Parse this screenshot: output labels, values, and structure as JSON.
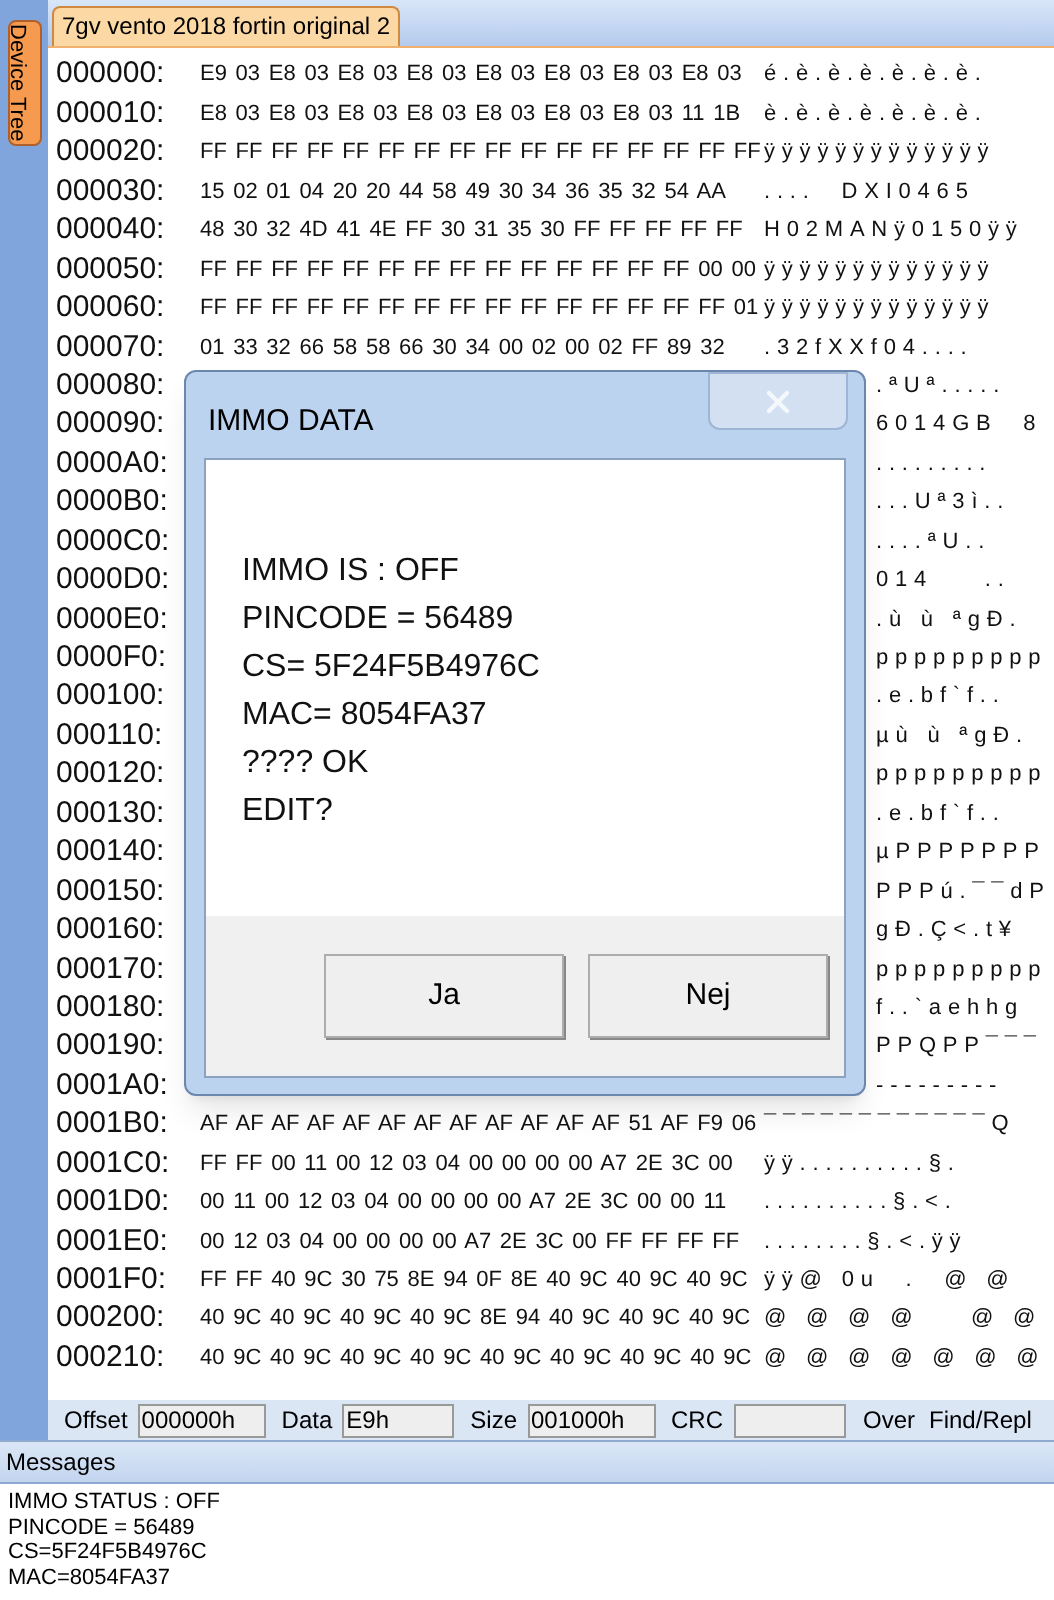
{
  "document_tab": {
    "title": "7gv vento 2018 fortin original 2",
    "selected": true
  },
  "side_tab": {
    "label": "Device Tree",
    "selected": true
  },
  "rows": [
    {
      "offset": "000000:",
      "hex": "E9 03 E8 03 E8 03 E8 03 E8 03 E8 03 E8 03 E8 03",
      "ascii": "é.è.è.è.è.è.è."
    },
    {
      "offset": "000010:",
      "hex": "E8 03 E8 03 E8 03 E8 03 E8 03 E8 03 E8 03 11 1B",
      "ascii": "è.è.è.è.è.è.è."
    },
    {
      "offset": "000020:",
      "hex": "FF FF FF FF FF FF FF FF FF FF FF FF FF FF FF FF",
      "ascii": "ÿÿÿÿÿÿÿÿÿÿÿÿÿ"
    },
    {
      "offset": "000030:",
      "hex": "15 02 01 04 20 20 44 58 49 30 34 36 35 32 54 AA",
      "ascii": "....  DXI0465"
    },
    {
      "offset": "000040:",
      "hex": "48 30 32 4D 41 4E FF 30 31 35 30 FF FF FF FF FF",
      "ascii": "H02MANÿ0150ÿÿ"
    },
    {
      "offset": "000050:",
      "hex": "FF FF FF FF FF FF FF FF FF FF FF FF FF FF 00 00",
      "ascii": "ÿÿÿÿÿÿÿÿÿÿÿÿÿ"
    },
    {
      "offset": "000060:",
      "hex": "FF FF FF FF FF FF FF FF FF FF FF FF FF FF FF 01",
      "ascii": "ÿÿÿÿÿÿÿÿÿÿÿÿÿ"
    },
    {
      "offset": "000070:",
      "hex": "01 33 32 66 58 58 66 30 34 00 02 00 02 FF 89 32",
      "ascii": ".32fXXf04...."
    },
    {
      "offset": "000080:",
      "ascii": ".ªUª....."
    },
    {
      "offset": "000090:",
      "ascii": "6014GB  8"
    },
    {
      "offset": "0000A0:",
      "ascii": "........."
    },
    {
      "offset": "0000B0:",
      "ascii": "...Uª3ì.."
    },
    {
      "offset": "0000C0:",
      "ascii": "....ªU.."
    },
    {
      "offset": "0000D0:",
      "ascii": "014    .."
    },
    {
      "offset": "0000E0:",
      "ascii": ".ù ù ªgÐ."
    },
    {
      "offset": "0000F0:",
      "ascii": "ppppppppp"
    },
    {
      "offset": "000100:",
      "ascii": ".e.bf`f.."
    },
    {
      "offset": "000110:",
      "ascii": "µù ù ªgÐ."
    },
    {
      "offset": "000120:",
      "ascii": "ppppppppp"
    },
    {
      "offset": "000130:",
      "ascii": ".e.bf`f.."
    },
    {
      "offset": "000140:",
      "ascii": "µPPPPPPP"
    },
    {
      "offset": "000150:",
      "ascii": "PPPú.¯¯dP"
    },
    {
      "offset": "000160:",
      "ascii": "gÐ.Ç<.t¥"
    },
    {
      "offset": "000170:",
      "ascii": "ppppppppp"
    },
    {
      "offset": "000180:",
      "ascii": "f..`aehhg"
    },
    {
      "offset": "000190:",
      "ascii": "PPQPP¯¯¯"
    },
    {
      "offset": "0001A0:",
      "ascii": "---------"
    },
    {
      "offset": "0001B0:",
      "hex": "AF AF AF AF AF AF AF AF AF AF AF AF 51 AF F9 06",
      "ascii": "¯¯¯¯¯¯¯¯¯¯¯¯Q"
    },
    {
      "offset": "0001C0:",
      "hex": "FF FF 00 11 00 12 03 04 00 00 00 00 A7 2E 3C 00",
      "ascii": "ÿÿ..........§."
    },
    {
      "offset": "0001D0:",
      "hex": "00 11 00 12 03 04 00 00 00 00 A7 2E 3C 00 00 11",
      "ascii": "..........§.<."
    },
    {
      "offset": "0001E0:",
      "hex": "00 12 03 04 00 00 00 00 A7 2E 3C 00 FF FF FF FF",
      "ascii": "........§.<.ÿÿ"
    },
    {
      "offset": "0001F0:",
      "hex": "FF FF 40 9C 30 75 8E 94 0F 8E 40 9C 40 9C 40 9C",
      "ascii": "ÿÿ@ 0u  .  @ @"
    },
    {
      "offset": "000200:",
      "hex": "40 9C 40 9C 40 9C 40 9C 8E 94 40 9C 40 9C 40 9C",
      "ascii": "@ @ @ @    @ @"
    },
    {
      "offset": "000210:",
      "hex": "40 9C 40 9C 40 9C 40 9C 40 9C 40 9C 40 9C 40 9C",
      "ascii": "@ @ @ @ @ @ @"
    }
  ],
  "status_bar": {
    "fields": [
      {
        "label": "Offset",
        "value": "000000h"
      },
      {
        "label": "Data",
        "value": "E9h"
      },
      {
        "label": "Size",
        "value": "001000h"
      },
      {
        "label": "CRC"
      }
    ],
    "mode": "Over",
    "find": "Find/Repl"
  },
  "messages": {
    "title": "Messages",
    "lines": [
      "IMMO STATUS : OFF",
      "PINCODE = 56489",
      "CS=5F24F5B4976C",
      "MAC=8054FA37"
    ]
  },
  "dialog": {
    "title": "IMMO DATA",
    "lines": [
      "IMMO IS : OFF",
      "PINCODE = 56489",
      "CS= 5F24F5B4976C",
      "MAC= 8054FA37",
      "???? OK",
      "EDIT?"
    ],
    "buttons": [
      "Ja",
      "Nej"
    ]
  }
}
